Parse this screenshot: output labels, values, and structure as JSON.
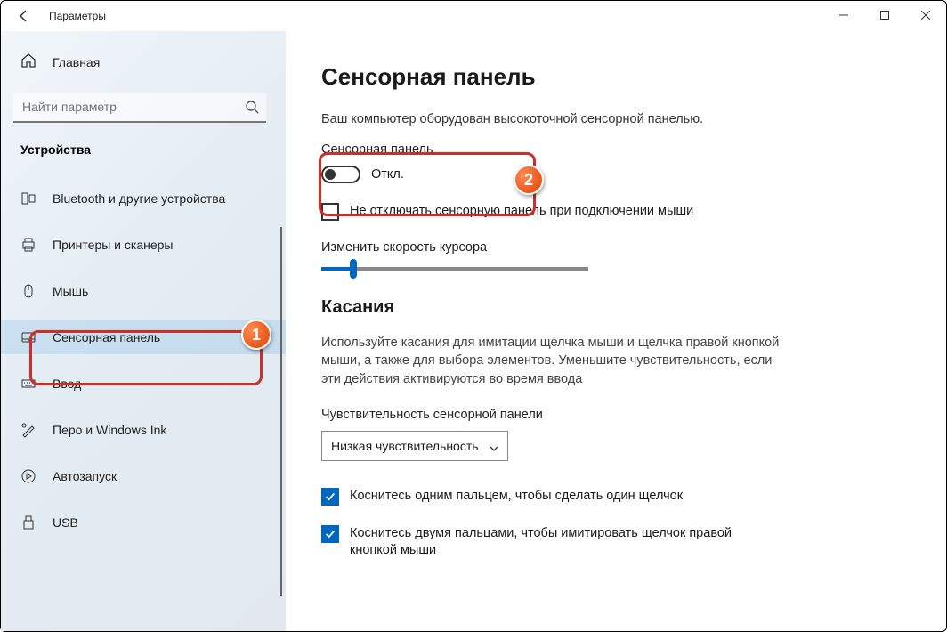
{
  "window": {
    "title": "Параметры"
  },
  "sidebar": {
    "home": "Главная",
    "search_placeholder": "Найти параметр",
    "section": "Устройства",
    "items": [
      {
        "label": "Bluetooth и другие устройства"
      },
      {
        "label": "Принтеры и сканеры"
      },
      {
        "label": "Мышь"
      },
      {
        "label": "Сенсорная панель"
      },
      {
        "label": "Ввод"
      },
      {
        "label": "Перо и Windows Ink"
      },
      {
        "label": "Автозапуск"
      },
      {
        "label": "USB"
      }
    ]
  },
  "main": {
    "heading": "Сенсорная панель",
    "subtext": "Ваш компьютер оборудован высокоточной сенсорной панелью.",
    "toggle_label": "Сенсорная панель",
    "toggle_state": "Откл.",
    "keep_on_mouse": "Не отключать сенсорную панель при подключении мыши",
    "cursor_speed_label": "Изменить скорость курсора",
    "touches_heading": "Касания",
    "touches_desc": "Используйте касания для имитации щелчка мыши и щелчка правой кнопкой мыши, а также для выбора элементов. Уменьшите чувствительность, если эти действия активируются во время ввода",
    "sensitivity_label": "Чувствительность сенсорной панели",
    "sensitivity_value": "Низкая чувствительность",
    "tap1": "Коснитесь одним пальцем, чтобы сделать один щелчок",
    "tap2": "Коснитесь двумя пальцами, чтобы имитировать щелчок правой кнопкой мыши"
  },
  "annotations": {
    "badge1": "1",
    "badge2": "2"
  }
}
